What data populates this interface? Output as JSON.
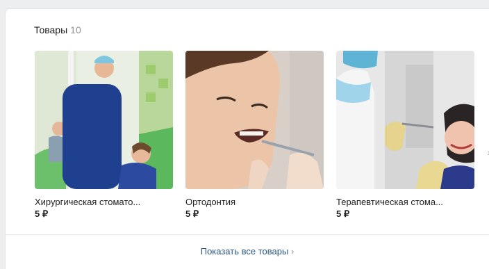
{
  "section": {
    "title": "Товары",
    "count": "10",
    "items": [
      {
        "name": "Хирургическая стомато...",
        "price": "5 ₽"
      },
      {
        "name": "Ортодонтия",
        "price": "5 ₽"
      },
      {
        "name": "Терапевтическая стома...",
        "price": "5 ₽"
      }
    ],
    "show_all_label": "Показать все товары",
    "show_all_arrow": "›"
  },
  "colors": {
    "link": "#2a5885",
    "card_bg": "#ffffff",
    "page_bg": "#edeef0"
  },
  "icons": {
    "next_arrow": "chevron-right-icon"
  }
}
